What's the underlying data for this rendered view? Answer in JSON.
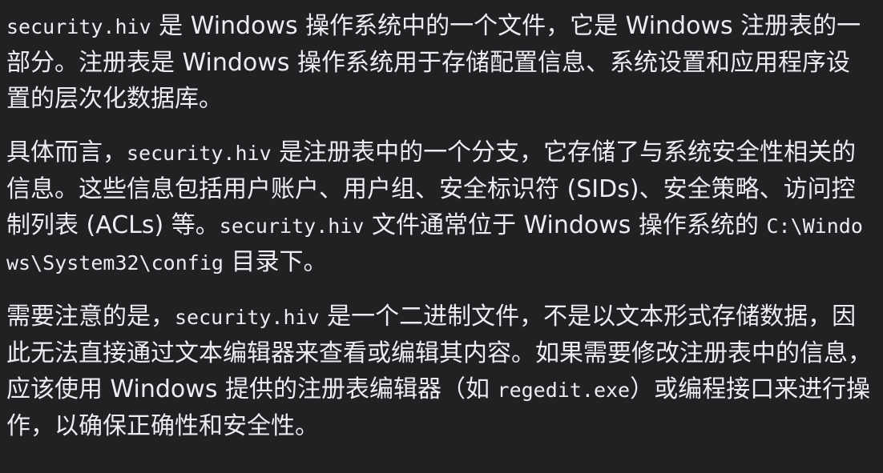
{
  "message": {
    "paragraphs": [
      {
        "segments": [
          {
            "type": "code",
            "text": "security.hiv"
          },
          {
            "type": "text",
            "text": " 是 Windows 操作系统中的一个文件，它是 Windows 注册表的一部分。注册表是 Windows 操作系统用于存储配置信息、系统设置和应用程序设置的层次化数据库。"
          }
        ]
      },
      {
        "segments": [
          {
            "type": "text",
            "text": "具体而言，"
          },
          {
            "type": "code",
            "text": "security.hiv"
          },
          {
            "type": "text",
            "text": " 是注册表中的一个分支，它存储了与系统安全性相关的信息。这些信息包括用户账户、用户组、安全标识符 (SIDs)、安全策略、访问控制列表 (ACLs) 等。"
          },
          {
            "type": "code",
            "text": "security.hiv"
          },
          {
            "type": "text",
            "text": " 文件通常位于 Windows 操作系统的 "
          },
          {
            "type": "code",
            "text": "C:\\Windows\\System32\\config"
          },
          {
            "type": "text",
            "text": " 目录下。"
          }
        ]
      },
      {
        "segments": [
          {
            "type": "text",
            "text": "需要注意的是，"
          },
          {
            "type": "code",
            "text": "security.hiv"
          },
          {
            "type": "text",
            "text": " 是一个二进制文件，不是以文本形式存储数据，因此无法直接通过文本编辑器来查看或编辑其内容。如果需要修改注册表中的信息，应该使用 Windows 提供的注册表编辑器（如 "
          },
          {
            "type": "code",
            "text": "regedit.exe"
          },
          {
            "type": "text",
            "text": "）或编程接口来进行操作，以确保正确性和安全性。"
          }
        ]
      }
    ]
  },
  "colors": {
    "background": "#202123",
    "text": "#ececf1"
  }
}
